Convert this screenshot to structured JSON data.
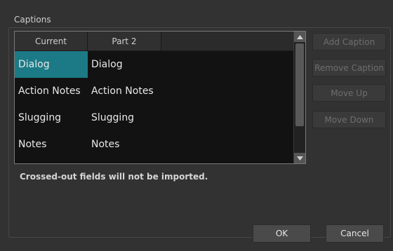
{
  "group": {
    "title": "Captions"
  },
  "table": {
    "columns": [
      "Current",
      "Part 2"
    ],
    "rows": [
      {
        "current": "Dialog",
        "part2": "Dialog",
        "selected": true
      },
      {
        "current": "Action Notes",
        "part2": "Action Notes",
        "selected": false
      },
      {
        "current": "Slugging",
        "part2": "Slugging",
        "selected": false
      },
      {
        "current": "Notes",
        "part2": "Notes",
        "selected": false
      }
    ]
  },
  "side_buttons": {
    "add": "Add Caption",
    "remove": "Remove Caption",
    "move_up": "Move Up",
    "move_down": "Move Down"
  },
  "note": "Crossed-out fields will not be imported.",
  "dialog_buttons": {
    "ok": "OK",
    "cancel": "Cancel"
  },
  "colors": {
    "selection": "#1c7a86",
    "background": "#323232",
    "table_background": "#121212"
  }
}
